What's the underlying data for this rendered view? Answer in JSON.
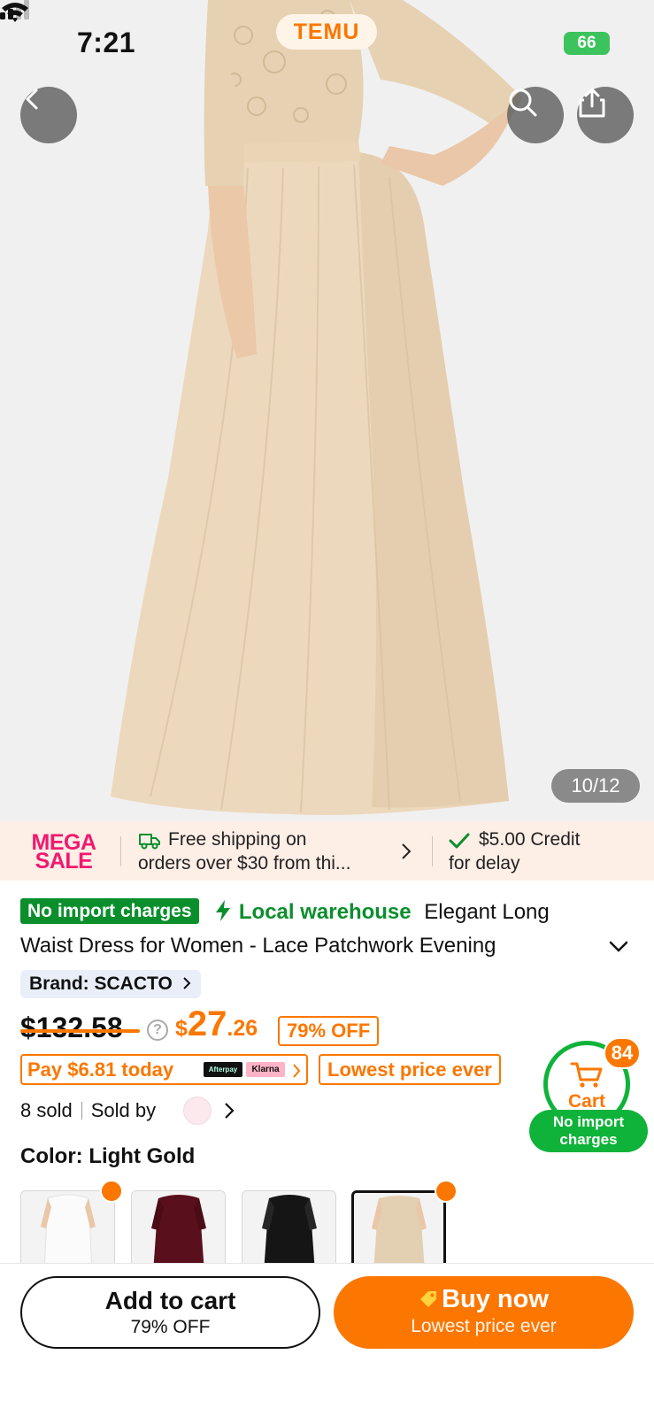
{
  "status_bar": {
    "time": "7:21",
    "app_pill": "TEMU",
    "battery": "66"
  },
  "gallery": {
    "counter": "10/12"
  },
  "promo": {
    "sale_line1": "MEGA",
    "sale_line2": "SALE",
    "shipping_line1": "Free shipping on",
    "shipping_line2": "orders over $30 from thi...",
    "credit_line1": "$5.00 Credit",
    "credit_line2": "for delay"
  },
  "product": {
    "tag_import": "No import charges",
    "tag_local": "Local warehouse",
    "title_line1": "Elegant Long",
    "title_line2": "Waist Dress for Women - Lace Patchwork Evening",
    "brand": "Brand: SCACTO",
    "old_price": "$132.58",
    "price_currency": "$",
    "price_int": "27",
    "price_dec": ".26",
    "discount": "79% OFF",
    "pay_today": "Pay $6.81 today",
    "afterpay": "Afterpay",
    "klarna": "Klarna",
    "lowest_price": "Lowest price ever",
    "sold_count": "8 sold",
    "sold_by": "Sold by"
  },
  "cart_float": {
    "count": "84",
    "label": "Cart",
    "badge_line1": "No import",
    "badge_line2": "charges"
  },
  "color": {
    "label": "Color: Light Gold",
    "swatches": [
      {
        "name": "White",
        "color": "#f7f7f7"
      },
      {
        "name": "Burgundy",
        "color": "#5a0f1c"
      },
      {
        "name": "Black",
        "color": "#151515"
      },
      {
        "name": "Light Gold",
        "color": "#e3cfb1"
      }
    ]
  },
  "bottom_bar": {
    "add_to_cart": "Add to cart",
    "add_to_cart_sub": "79% OFF",
    "buy_now": "Buy now",
    "buy_now_sub": "Lowest price ever"
  },
  "colors": {
    "accent": "#fb7701",
    "green": "#0fb33a",
    "mega_sale": "#f0196f"
  }
}
